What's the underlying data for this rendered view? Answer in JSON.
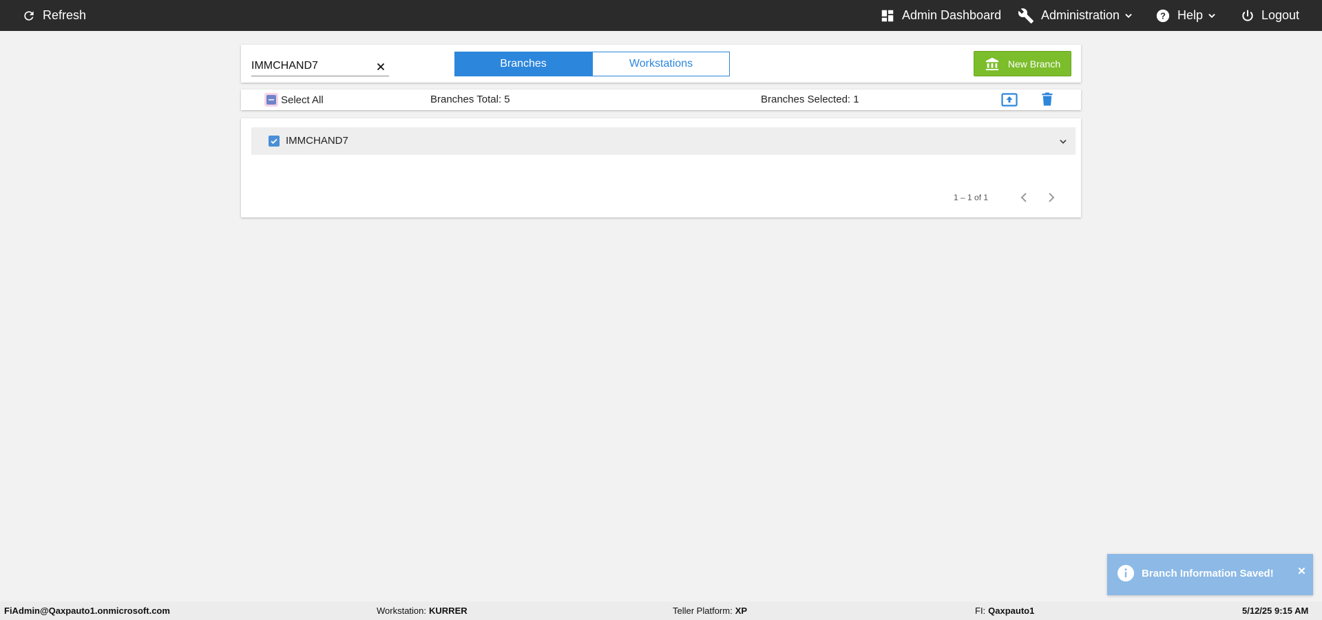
{
  "topbar": {
    "refresh_label": "Refresh",
    "admin_dashboard_label": "Admin Dashboard",
    "administration_label": "Administration",
    "help_label": "Help",
    "logout_label": "Logout"
  },
  "search": {
    "value": "IMMCHAND7",
    "placeholder": ""
  },
  "tabs": [
    {
      "label": "Branches",
      "active": true
    },
    {
      "label": "Workstations",
      "active": false
    }
  ],
  "actions": {
    "new_branch_label": "New Branch"
  },
  "selection_bar": {
    "select_all_label": "Select All",
    "branches_total": "Branches Total: 5",
    "branches_selected": "Branches Selected: 1"
  },
  "branches": [
    {
      "name": "IMMCHAND7",
      "checked": true
    }
  ],
  "paginator": {
    "range": "1 – 1 of 1"
  },
  "toast": {
    "message": "Branch Information Saved!"
  },
  "footer": {
    "user": "FiAdmin@Qaxpauto1.onmicrosoft.com",
    "workstation_label": "Workstation:",
    "workstation_value": "KURRER",
    "teller_platform_label": "Teller Platform:",
    "teller_platform_value": "XP",
    "fi_label": "FI:",
    "fi_value": "Qaxpauto1",
    "datetime": "5/12/25 9:15 AM"
  },
  "colors": {
    "topbar": "#2b2b2b",
    "primary_blue": "#2c86dc",
    "new_branch_green": "#7cbd2c",
    "toast_blue": "#8cb9e6",
    "background": "#f2f2f2"
  },
  "icons": {
    "refresh": "refresh-icon",
    "dashboard": "dashboard-icon",
    "administration": "wrench-icon",
    "help": "help-icon",
    "logout": "power-icon",
    "new_branch": "bank-icon",
    "export": "upload-icon",
    "delete": "trash-icon",
    "toast": "info-icon"
  }
}
